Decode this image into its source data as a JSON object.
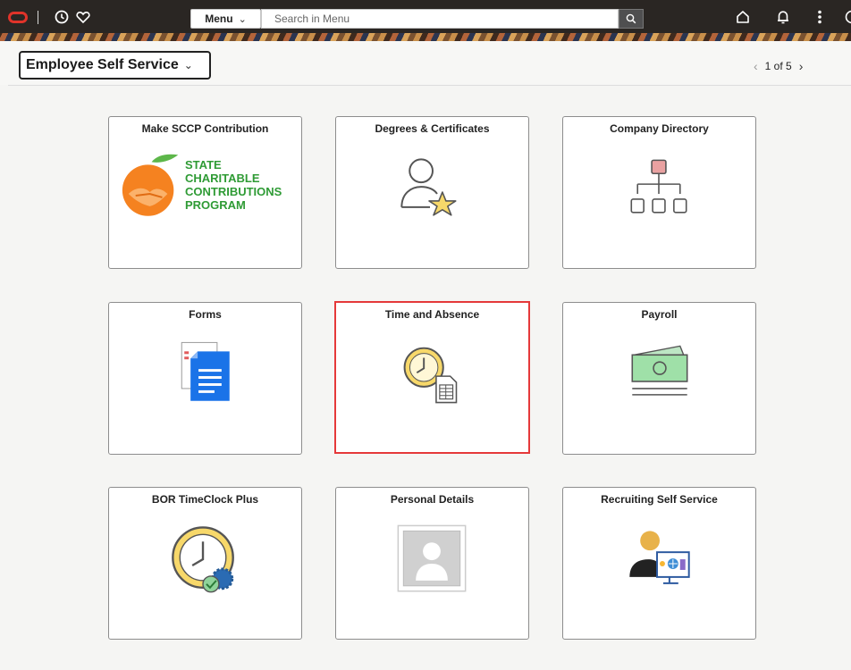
{
  "header": {
    "menu_label": "Menu",
    "search_placeholder": "Search in Menu",
    "icons": [
      "oracle-logo",
      "history-icon",
      "favorites-icon",
      "search-icon",
      "home-icon",
      "notifications-icon",
      "actions-icon"
    ]
  },
  "page": {
    "title": "Employee Self Service",
    "pager": "1 of 5"
  },
  "tiles": [
    {
      "title": "Make SCCP Contribution",
      "icon": "sccp-logo",
      "logo_text": [
        "STATE",
        "CHARITABLE",
        "CONTRIBUTIONS",
        "PROGRAM"
      ]
    },
    {
      "title": "Degrees & Certificates",
      "icon": "person-star-icon"
    },
    {
      "title": "Company Directory",
      "icon": "org-chart-icon"
    },
    {
      "title": "Forms",
      "icon": "document-icon"
    },
    {
      "title": "Time and Absence",
      "icon": "clock-timesheet-icon",
      "selected": true
    },
    {
      "title": "Payroll",
      "icon": "money-icon"
    },
    {
      "title": "BOR TimeClock Plus",
      "icon": "clock-gear-icon"
    },
    {
      "title": "Personal Details",
      "icon": "person-photo-icon"
    },
    {
      "title": "Recruiting Self Service",
      "icon": "recruiting-icon"
    }
  ],
  "colors": {
    "topbar": "#2a2623",
    "oracle_red": "#e0332a",
    "selected_border": "#e5393a",
    "sccp_green": "#2f9b35",
    "sccp_orange": "#f58220"
  }
}
